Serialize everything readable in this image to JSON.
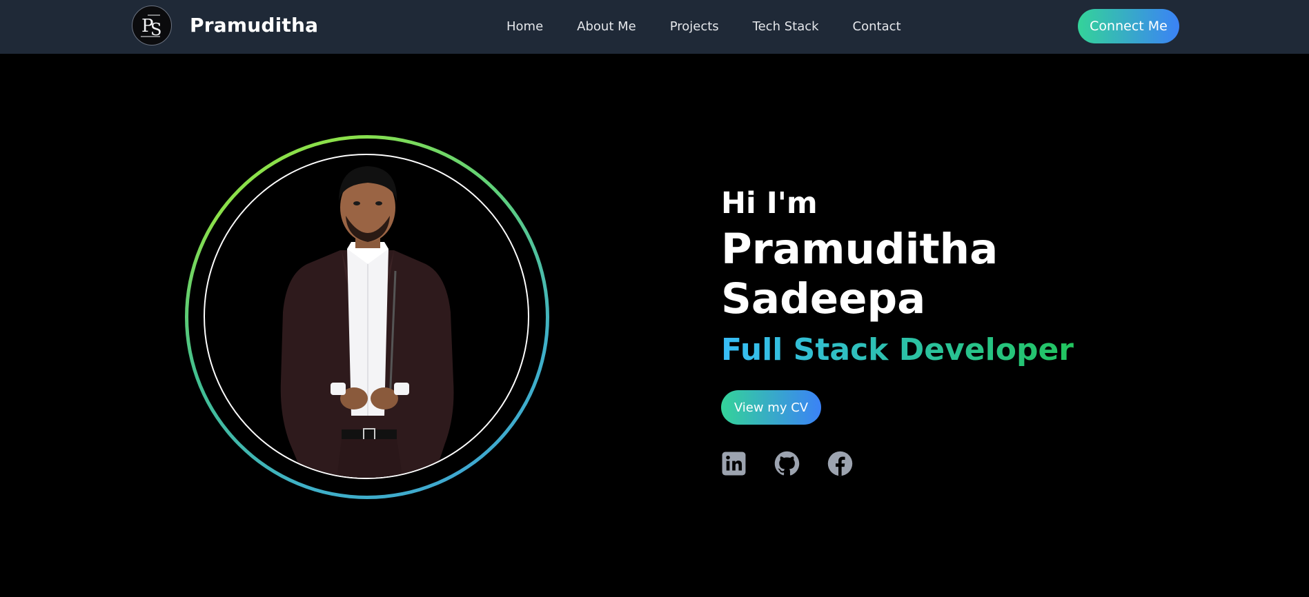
{
  "navbar": {
    "logo_initials": "PS",
    "brand": "Pramuditha",
    "links": [
      {
        "label": "Home"
      },
      {
        "label": "About Me"
      },
      {
        "label": "Projects"
      },
      {
        "label": "Tech Stack"
      },
      {
        "label": "Contact"
      }
    ],
    "cta_label": "Connect Me"
  },
  "hero": {
    "greeting": "Hi I'm",
    "name": "Pramuditha Sadeepa",
    "role": "Full Stack Developer",
    "cv_button_label": "View my CV",
    "socials": [
      {
        "icon": "linkedin-icon"
      },
      {
        "icon": "github-icon"
      },
      {
        "icon": "facebook-icon"
      }
    ]
  },
  "colors": {
    "navbar_bg": "#1f2937",
    "page_bg": "#000000",
    "accent_gradient_start": "#34d399",
    "accent_gradient_end": "#3b82f6",
    "social_icon": "#9ca3af"
  }
}
